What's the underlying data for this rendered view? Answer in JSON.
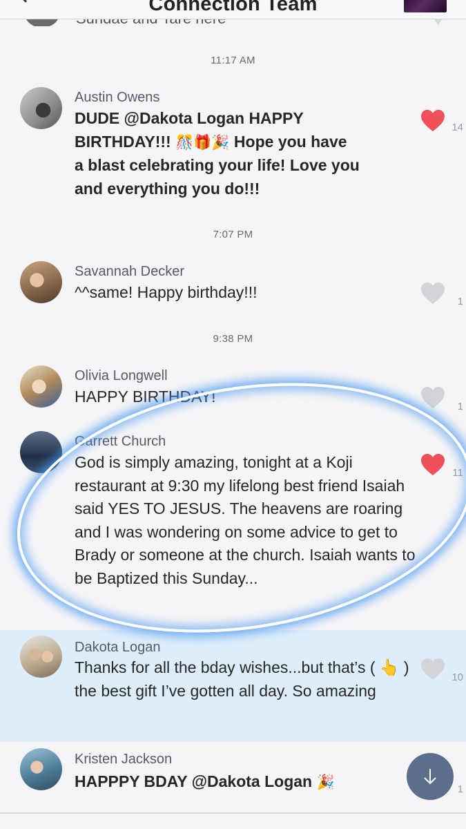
{
  "header": {
    "title": "Connection Team",
    "back_icon": "chevron-left-icon"
  },
  "top_peek": {
    "text": "Sundae and Tare here"
  },
  "timestamps": [
    "11:17 AM",
    "7:07 PM",
    "9:38 PM"
  ],
  "messages": [
    {
      "sender": "Austin Owens",
      "body": "DUDE @Dakota Logan  HAPPY BIRTHDAY!!! 🎊🎁🎉  Hope you have a blast celebrating your life! Love you and everything you do!!!",
      "line1": "DUDE @Dakota Logan  HAPPY",
      "line2_text": "BIRTHDAY!!!",
      "line2_emoji": "🎊🎁🎉",
      "line2_rest": " Hope you have",
      "line3": "a blast celebrating your life! Love you",
      "line4": "and everything you do!!!",
      "likes": "14",
      "liked": true
    },
    {
      "sender": "Savannah Decker",
      "body": "^^same! Happy birthday!!!",
      "likes": "1",
      "liked": false
    },
    {
      "sender": "Olivia Longwell",
      "body": "HAPPY BIRTHDAY!",
      "likes": "1",
      "liked": false
    },
    {
      "sender": "Garrett Church",
      "body": "God is simply amazing, tonight at a Koji restaurant at 9:30 my lifelong best friend Isaiah said YES TO JESUS. The heavens are roaring and I was wondering on some advice to get to Brady or someone at the church. Isaiah wants to be Baptized this Sunday...",
      "likes": "11",
      "liked": true
    },
    {
      "sender": "Dakota Logan",
      "body": "Thanks for all the bday wishes...but that’s ( 👆 ) the best gift I’ve gotten all day. So amazing",
      "likes": "10",
      "liked": false
    },
    {
      "sender": "Kristen Jackson",
      "body_text": "HAPPPY BDAY @Dakota Logan",
      "body_emoji": "🎉",
      "likes": "1",
      "liked": false
    }
  ],
  "colors": {
    "heart_liked": "#f0505a",
    "heart_unliked": "#d4d4d8",
    "highlight_row": "#ddeefa",
    "annotation_glow": "#4696f0",
    "scroll_button": "#5b6f8c"
  },
  "scroll_button_icon": "arrow-down-icon"
}
